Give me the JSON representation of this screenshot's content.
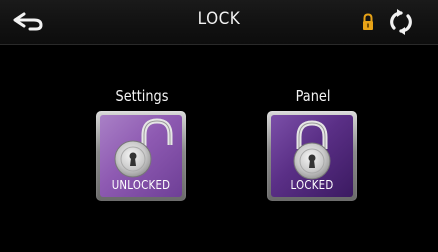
{
  "header": {
    "title": "LOCK",
    "back_icon": "back-arrow-icon",
    "status_icon": "padlock-icon",
    "refresh_icon": "refresh-icon"
  },
  "items": [
    {
      "label": "Settings",
      "state": "UNLOCKED",
      "icon": "open-padlock-icon"
    },
    {
      "label": "Panel",
      "state": "LOCKED",
      "icon": "closed-padlock-icon"
    }
  ],
  "colors": {
    "background": "#000000",
    "accent_purple": "#8e5ab2",
    "status_orange": "#e8a317"
  }
}
